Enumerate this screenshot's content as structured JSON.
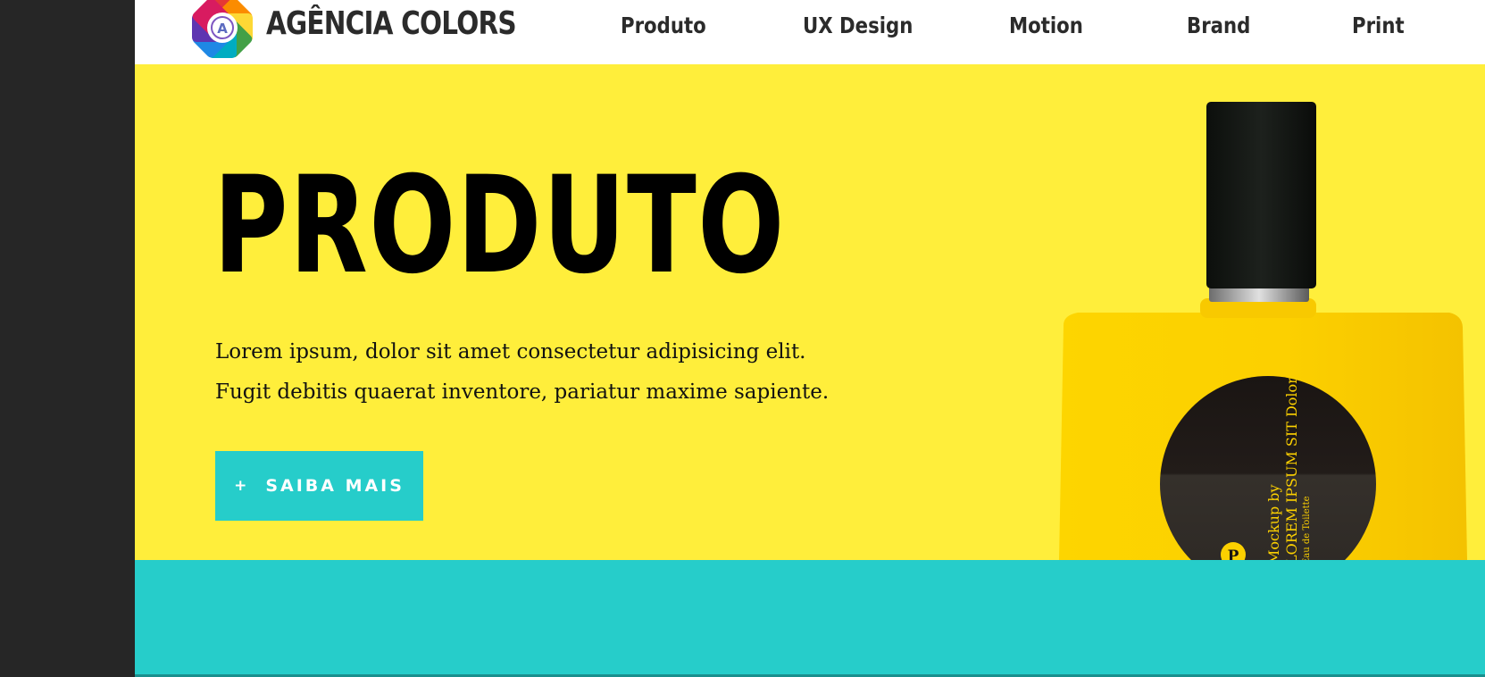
{
  "brand": {
    "name": "AGÊNCIA COLORS",
    "logo_letter": "A"
  },
  "nav": {
    "items": [
      {
        "label": "Produto"
      },
      {
        "label": "UX Design"
      },
      {
        "label": "Motion"
      },
      {
        "label": "Brand"
      },
      {
        "label": "Print"
      }
    ]
  },
  "hero": {
    "title": "PRODUTO",
    "text": "Lorem ipsum, dolor sit amet consectetur adipisicing elit. Fugit debitis quaerat inventore, pariatur maxime sapiente.",
    "cta": {
      "icon": "+",
      "label": "SAIBA MAIS"
    }
  },
  "product_label": {
    "line1": "Mockup by",
    "line2": "LOREM IPSUM SIT Dolor",
    "line3": "Eau de Toilette",
    "badge": "P"
  },
  "colors": {
    "hero_bg": "#ffee3b",
    "accent_teal": "#26cdca",
    "side_panel": "#262626",
    "bottle_yellow": "#fccd00"
  }
}
